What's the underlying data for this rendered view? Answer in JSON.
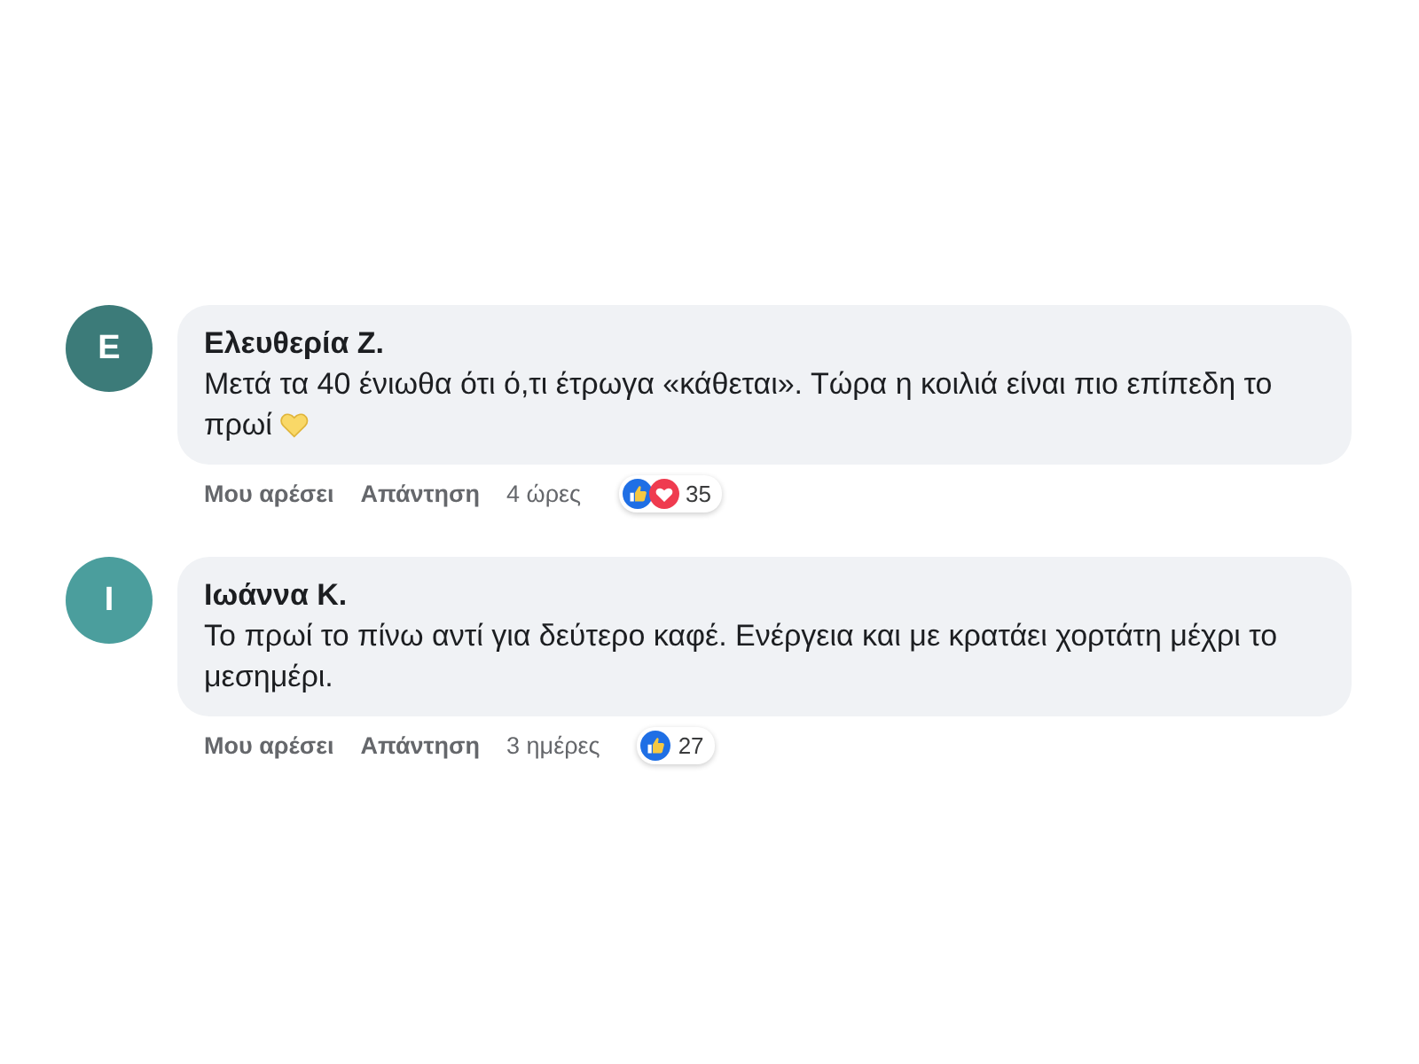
{
  "comments": [
    {
      "avatar": {
        "initial": "Ε",
        "color": "#3c7b79"
      },
      "author": "Ελευθερία Ζ.",
      "text_lines": [
        "Μετά τα 40 ένιωθα ότι ό,τι έτρωγα «κάθεται». Τώρα η κοιλιά είναι πιο επίπεδη το",
        "πρωί"
      ],
      "emoji": {
        "kind": "yellow-heart"
      },
      "actions": [
        {
          "label": "Μου αρέσει"
        },
        {
          "label": "Απάντηση"
        }
      ],
      "time": "4 ώρες",
      "reactions": [
        {
          "kind": "like"
        },
        {
          "kind": "love"
        }
      ],
      "reaction_count": "35"
    },
    {
      "avatar": {
        "initial": "Ι",
        "color": "#4b9e9d"
      },
      "author": "Ιωάννα Κ.",
      "text_lines": [
        "Το πρωί το πίνω αντί για δεύτερο καφέ. Ενέργεια και με κρατάει χορτάτη μέχρι το",
        "μεσημέρι."
      ],
      "actions": [
        {
          "label": "Μου αρέσει"
        },
        {
          "label": "Απάντηση"
        }
      ],
      "time": "3 ημέρες",
      "reactions": [
        {
          "kind": "like"
        }
      ],
      "reaction_count": "27"
    }
  ]
}
